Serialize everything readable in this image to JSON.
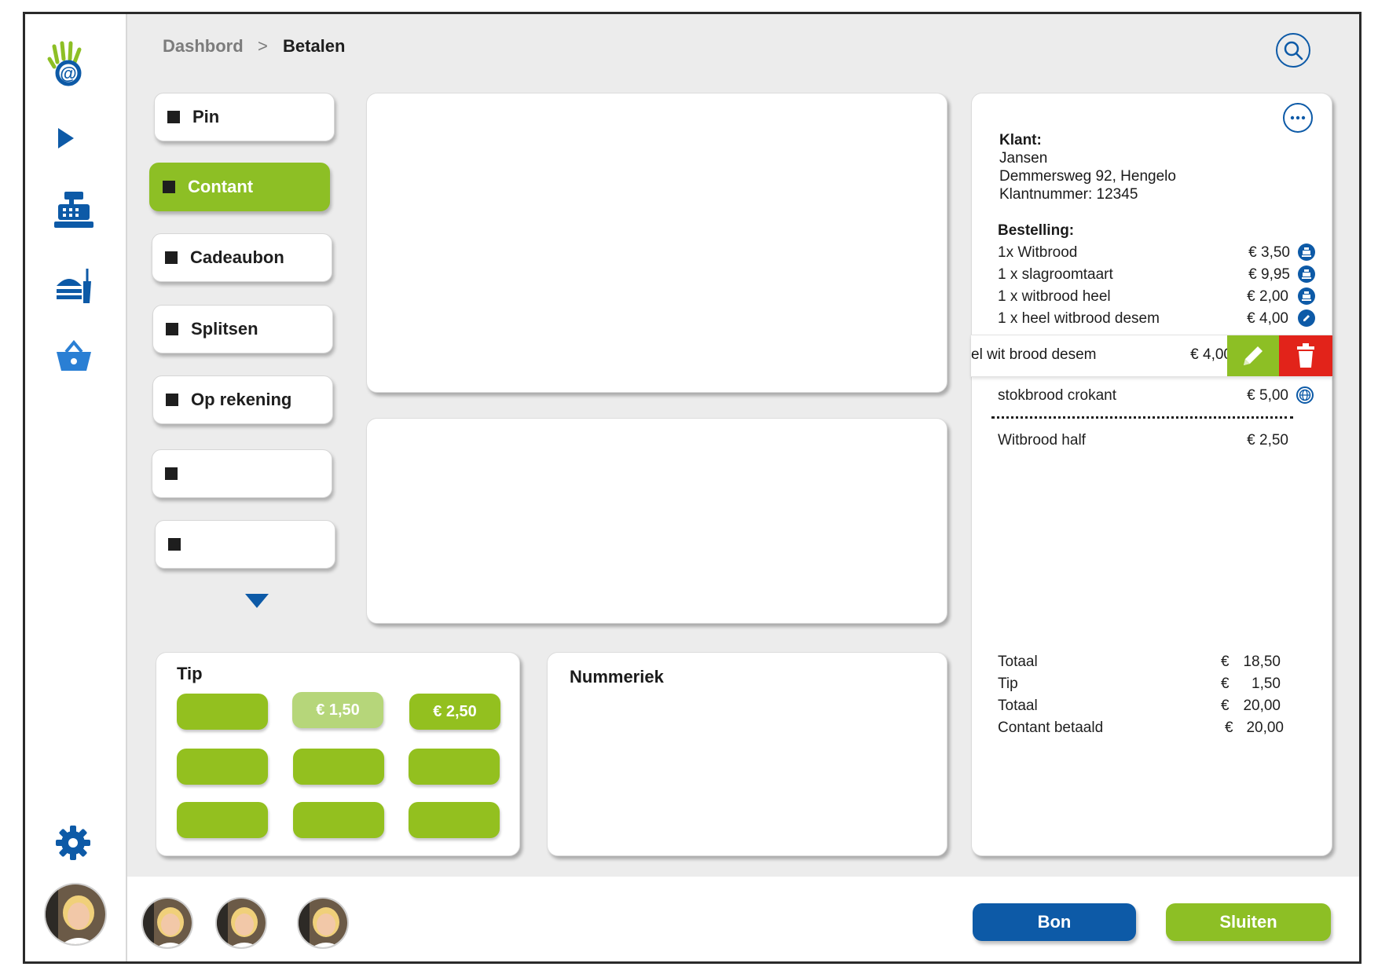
{
  "breadcrumb": {
    "parent": "Dashbord",
    "separator": ">",
    "current": "Betalen"
  },
  "payment_methods": [
    {
      "label": "Pin"
    },
    {
      "label": "Contant"
    },
    {
      "label": "Cadeaubon"
    },
    {
      "label": "Splitsen"
    },
    {
      "label": "Op rekening"
    },
    {
      "label": ""
    },
    {
      "label": ""
    }
  ],
  "tip": {
    "title": "Tip",
    "buttons": [
      "",
      "€ 1,50",
      "€ 2,50",
      "",
      "",
      "",
      "",
      "",
      ""
    ]
  },
  "numeriek": {
    "title": "Nummeriek"
  },
  "customer": {
    "label": "Klant:",
    "name": "Jansen",
    "address": "Demmersweg 92, Hengelo",
    "number": "Klantnummer: 12345"
  },
  "order": {
    "label": "Bestelling:",
    "items": [
      {
        "name": "1x Witbrood",
        "price": "€ 3,50",
        "icon": "register-icon"
      },
      {
        "name": "1 x slagroomtaart",
        "price": "€ 9,95",
        "icon": "register-icon"
      },
      {
        "name": "1 x witbrood heel",
        "price": "€ 2,00",
        "icon": "register-icon"
      },
      {
        "name": "1 x heel witbrood desem",
        "price": "€ 4,00",
        "icon": "pencil-icon"
      }
    ],
    "swiped_item": {
      "name": "el wit brood desem",
      "price": "€ 4,00"
    },
    "extra_items": [
      {
        "name": "stokbrood crokant",
        "price": "€ 5,00",
        "icon": "globe-icon"
      },
      {
        "name": "Witbrood half",
        "price": "€ 2,50"
      }
    ]
  },
  "totals": [
    {
      "label": "Totaal",
      "currency": "€",
      "value": "18,50"
    },
    {
      "label": "Tip",
      "currency": "€",
      "value": "1,50"
    },
    {
      "label": "Totaal",
      "currency": "€",
      "value": "20,00"
    },
    {
      "label": "Contant betaald",
      "currency": "€",
      "value": "20,00"
    }
  ],
  "actions": {
    "bon": "Bon",
    "sluiten": "Sluiten"
  },
  "colors": {
    "green": "#8dbf25",
    "blue": "#0d5aa7",
    "red": "#e2231a",
    "background": "#ececec"
  }
}
